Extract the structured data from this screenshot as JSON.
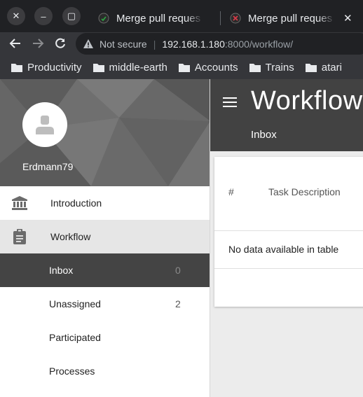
{
  "browser": {
    "tabs": [
      {
        "title": "Merge pull reques"
      },
      {
        "title": "Merge pull reques"
      }
    ],
    "tab_close": "✕",
    "security_label": "Not secure",
    "url_host": "192.168.1.180",
    "url_path": ":8000/workflow/",
    "bookmarks": [
      "Productivity",
      "middle-earth",
      "Accounts",
      "Trains",
      "atari"
    ]
  },
  "sidebar": {
    "username": "Erdmann79",
    "menu": [
      {
        "label": "Introduction",
        "icon": "bank-icon"
      },
      {
        "label": "Workflow",
        "icon": "clipboard-icon"
      }
    ],
    "submenu": [
      {
        "label": "Inbox",
        "count": "0"
      },
      {
        "label": "Unassigned",
        "count": "2"
      },
      {
        "label": "Participated",
        "count": ""
      },
      {
        "label": "Processes",
        "count": ""
      }
    ]
  },
  "main": {
    "title": "Workflow",
    "subtitle": "Inbox",
    "table": {
      "columns": [
        "#",
        "Task Description"
      ],
      "empty_message": "No data available in table"
    }
  },
  "colors": {
    "chrome_dark": "#202124",
    "chrome_bar": "#35363a",
    "header": "#424242",
    "selected_item": "#444444"
  }
}
